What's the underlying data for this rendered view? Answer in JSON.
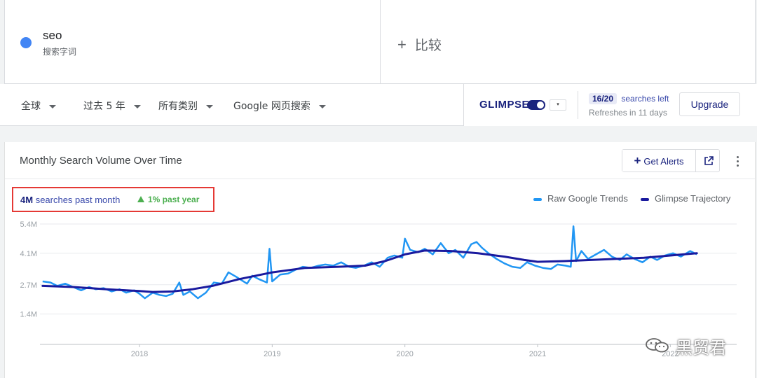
{
  "search_term": {
    "name": "seo",
    "type": "搜索字词",
    "dot_color": "#4285f4"
  },
  "compare": {
    "plus": "+",
    "label": "比较"
  },
  "filters": [
    {
      "label": "全球"
    },
    {
      "label": "过去 5 年"
    },
    {
      "label": "所有类别"
    },
    {
      "label": "Google 网页搜索"
    }
  ],
  "glimpse": {
    "logo": "GLIMPSE",
    "dropdown_glyph": "▾",
    "quota_used": "16/20",
    "quota_label": "searches left",
    "refresh": "Refreshes in 11 days",
    "upgrade_label": "Upgrade"
  },
  "chart_header": {
    "title": "Monthly Search Volume Over Time",
    "alerts_plus": "+",
    "alerts_label": "Get Alerts",
    "external_icon": "external-link-icon",
    "more_icon": "more-vert-icon"
  },
  "stats": {
    "volume_value": "4M",
    "volume_label": "searches past month",
    "growth_label": "1% past year",
    "highlight_color": "#e53935",
    "growth_color": "#4caf50"
  },
  "legend": {
    "raw_label": "Raw Google Trends",
    "raw_color": "#2196f3",
    "trajectory_label": "Glimpse Trajectory",
    "trajectory_color": "#1a1a9e"
  },
  "chart_data": {
    "type": "line",
    "y_ticks": [
      "5.4M",
      "4.1M",
      "2.7M",
      "1.4M"
    ],
    "y_tick_values": [
      5.4,
      4.1,
      2.7,
      1.4
    ],
    "ylim": [
      0.05,
      5.4
    ],
    "xlim": [
      2017.25,
      2022.5
    ],
    "x_ticks": [
      "2018",
      "2019",
      "2020",
      "2021",
      "2022"
    ],
    "x_tick_values": [
      2018,
      2019,
      2020,
      2021,
      2022
    ],
    "grid": true,
    "legend_position": "top-right",
    "series": [
      {
        "name": "Raw Google Trends",
        "x": [
          2017.27,
          2017.33,
          2017.38,
          2017.44,
          2017.5,
          2017.56,
          2017.62,
          2017.67,
          2017.73,
          2017.79,
          2017.85,
          2017.9,
          2017.96,
          2018.0,
          2018.04,
          2018.1,
          2018.15,
          2018.2,
          2018.25,
          2018.3,
          2018.33,
          2018.38,
          2018.44,
          2018.5,
          2018.56,
          2018.62,
          2018.67,
          2018.73,
          2018.77,
          2018.81,
          2018.85,
          2018.9,
          2018.96,
          2018.98,
          2019.0,
          2019.06,
          2019.12,
          2019.17,
          2019.23,
          2019.29,
          2019.35,
          2019.4,
          2019.46,
          2019.52,
          2019.58,
          2019.63,
          2019.69,
          2019.75,
          2019.81,
          2019.87,
          2019.92,
          2019.98,
          2020.0,
          2020.04,
          2020.1,
          2020.15,
          2020.21,
          2020.27,
          2020.33,
          2020.38,
          2020.44,
          2020.5,
          2020.54,
          2020.58,
          2020.63,
          2020.69,
          2020.75,
          2020.81,
          2020.87,
          2020.92,
          2020.98,
          2021.04,
          2021.1,
          2021.15,
          2021.21,
          2021.25,
          2021.27,
          2021.29,
          2021.33,
          2021.38,
          2021.44,
          2021.5,
          2021.56,
          2021.62,
          2021.67,
          2021.73,
          2021.79,
          2021.85,
          2021.9,
          2021.96,
          2022.02,
          2022.08,
          2022.15,
          2022.2
        ],
        "y": [
          2.85,
          2.8,
          2.65,
          2.75,
          2.6,
          2.45,
          2.6,
          2.5,
          2.55,
          2.4,
          2.5,
          2.35,
          2.45,
          2.3,
          2.1,
          2.35,
          2.25,
          2.2,
          2.3,
          2.8,
          2.25,
          2.4,
          2.1,
          2.35,
          2.8,
          2.75,
          3.25,
          3.05,
          2.9,
          2.75,
          3.1,
          2.95,
          2.8,
          4.3,
          2.85,
          3.15,
          3.2,
          3.35,
          3.5,
          3.45,
          3.55,
          3.6,
          3.55,
          3.7,
          3.5,
          3.45,
          3.55,
          3.7,
          3.5,
          3.9,
          4.0,
          3.9,
          4.75,
          4.25,
          4.15,
          4.3,
          4.05,
          4.55,
          4.1,
          4.25,
          3.9,
          4.5,
          4.6,
          4.35,
          4.1,
          3.85,
          3.65,
          3.5,
          3.45,
          3.7,
          3.55,
          3.45,
          3.4,
          3.6,
          3.55,
          3.5,
          5.3,
          3.75,
          4.2,
          3.85,
          4.05,
          4.25,
          3.95,
          3.8,
          4.05,
          3.85,
          3.7,
          3.95,
          3.8,
          4.0,
          4.1,
          3.95,
          4.2,
          4.05
        ]
      },
      {
        "name": "Glimpse Trajectory",
        "x": [
          2017.27,
          2017.5,
          2017.75,
          2018.0,
          2018.1,
          2018.25,
          2018.4,
          2018.55,
          2018.75,
          2019.0,
          2019.25,
          2019.5,
          2019.7,
          2019.85,
          2020.0,
          2020.15,
          2020.35,
          2020.55,
          2020.75,
          2020.9,
          2021.0,
          2021.2,
          2021.4,
          2021.6,
          2021.8,
          2022.0,
          2022.2
        ],
        "y": [
          2.65,
          2.6,
          2.5,
          2.42,
          2.38,
          2.4,
          2.5,
          2.65,
          2.95,
          3.25,
          3.45,
          3.5,
          3.55,
          3.75,
          4.05,
          4.22,
          4.2,
          4.1,
          3.95,
          3.8,
          3.72,
          3.75,
          3.8,
          3.85,
          3.9,
          4.0,
          4.1
        ]
      }
    ]
  },
  "watermark": {
    "text": "黑贸君",
    "icon": "wechat-icon"
  }
}
